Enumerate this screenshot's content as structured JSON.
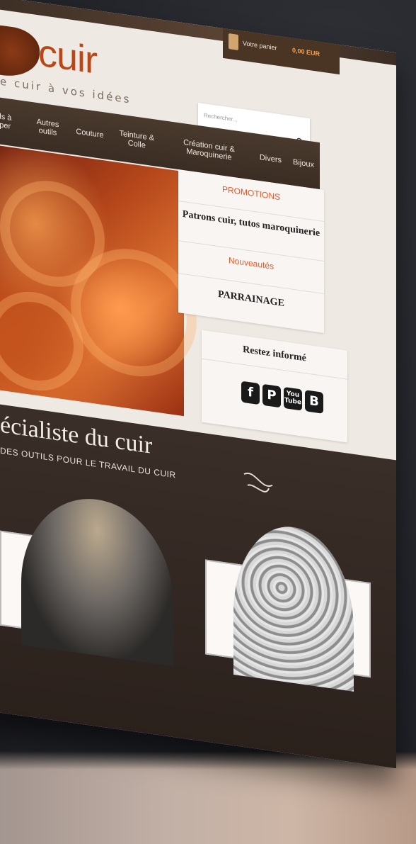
{
  "site": {
    "logo_text": "cuir",
    "tagline": "e cuir à vos idées"
  },
  "cart": {
    "label": "Votre panier",
    "amount": "0,00 EUR"
  },
  "search": {
    "placeholder": "Rechercher..."
  },
  "nav": {
    "items": [
      "Outils à frapper",
      "Autres outils",
      "Couture",
      "Teinture & Colle",
      "Création cuir & Maroquinerie",
      "Divers",
      "Bijoux"
    ]
  },
  "promo": {
    "promotions": "PROMOTIONS",
    "patrons": "Patrons cuir, tutos maroquinerie",
    "nouveautes": "Nouveautés",
    "parrainage": "PARRAINAGE"
  },
  "inform": {
    "title": "Restez informé",
    "social": [
      "facebook-icon",
      "pinterest-icon",
      "youtube-icon",
      "blogger-icon"
    ]
  },
  "section": {
    "title": "écialiste du cuir",
    "subtitle": "DES OUTILS POUR LE TRAVAIL DU CUIR"
  },
  "colors": {
    "accent": "#b94818",
    "nav_bg": "#3f3128",
    "dark_bg": "#2b211c"
  }
}
